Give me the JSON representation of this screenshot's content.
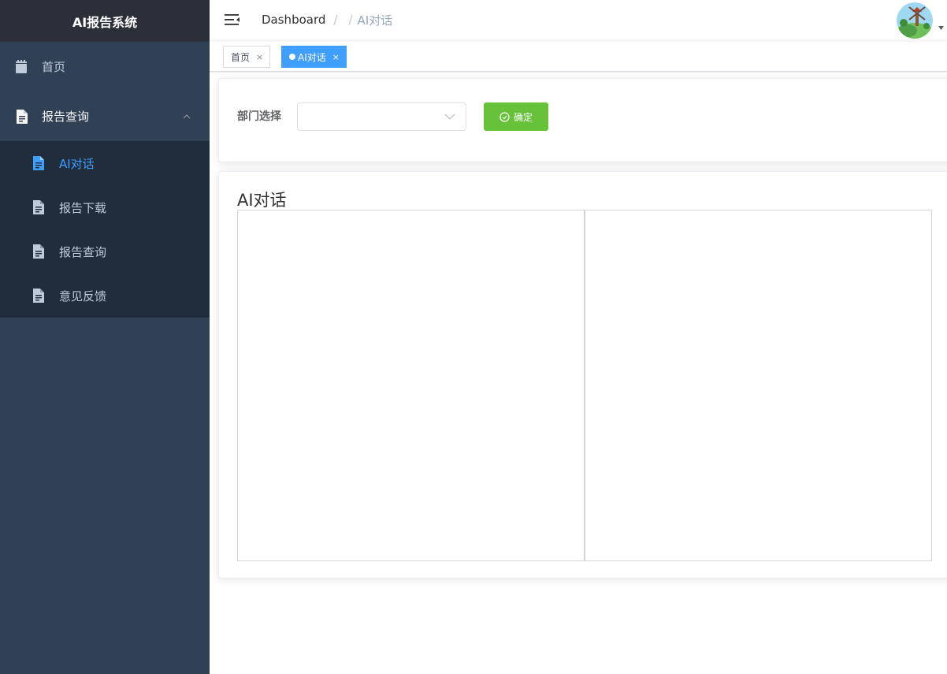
{
  "sidebar": {
    "logo": "AI报告系统",
    "home_label": "首页",
    "group_label": "报告查询",
    "items": [
      {
        "label": "AI对话"
      },
      {
        "label": "报告下载"
      },
      {
        "label": "报告查询"
      },
      {
        "label": "意见反馈"
      }
    ]
  },
  "navbar": {
    "breadcrumb_home": "Dashboard",
    "breadcrumb_sep1": "/",
    "breadcrumb_sep2": "/",
    "breadcrumb_current": "AI对话"
  },
  "tags": [
    {
      "label": "首页",
      "close": "×"
    },
    {
      "label": "AI对话",
      "close": "×"
    }
  ],
  "form": {
    "department_label": "部门选择",
    "department_value": "",
    "confirm_label": "确定"
  },
  "chat": {
    "title": "AI对话"
  },
  "colors": {
    "sidebar_bg": "#304156",
    "submenu_bg": "#1f2d3d",
    "accent": "#409eff",
    "confirm": "#67c23a"
  },
  "icons": [
    "menu-fold-icon",
    "document-icon",
    "chevron-up-icon",
    "chevron-down-icon",
    "check-circle-icon",
    "caret-down-icon"
  ]
}
